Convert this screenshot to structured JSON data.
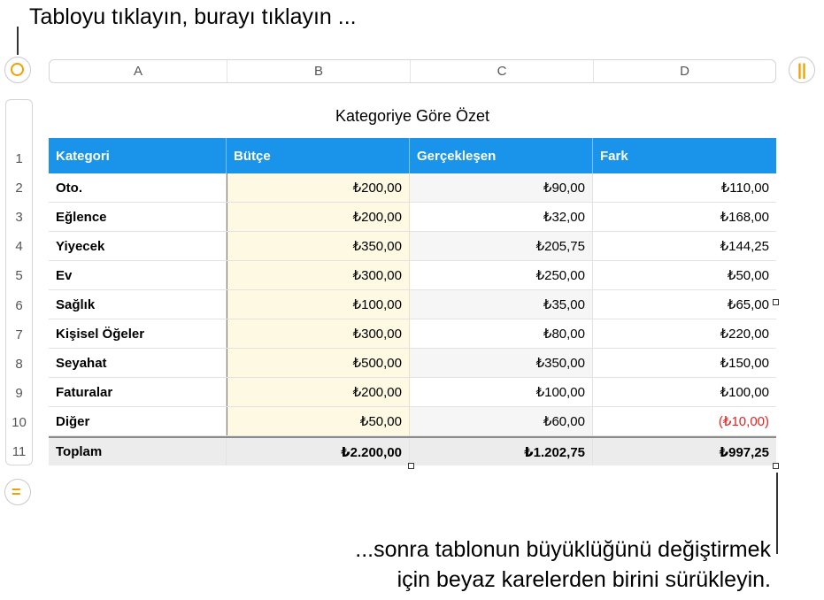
{
  "callouts": {
    "top": "Tabloyu tıklayın, burayı tıklayın ...",
    "bottom_line1": "...sonra tablonun büyüklüğünü değiştirmek",
    "bottom_line2": "için beyaz karelerden birini sürükleyin."
  },
  "colors": {
    "accent": "#f0a000",
    "header_blue": "#1a94ea",
    "negative": "#e02424",
    "budget_fill": "#fdf9e3"
  },
  "icons": {
    "select_table": "circle-select-icon",
    "column_handle": "double-bar-icon",
    "row_handle": "equals-icon"
  },
  "column_letters": [
    "A",
    "B",
    "C",
    "D"
  ],
  "row_numbers": [
    "1",
    "2",
    "3",
    "4",
    "5",
    "6",
    "7",
    "8",
    "9",
    "10",
    "11"
  ],
  "table": {
    "title": "Kategoriye Göre Özet",
    "headers": [
      "Kategori",
      "Bütçe",
      "Gerçekleşen",
      "Fark"
    ],
    "rows": [
      {
        "category": "Oto.",
        "budget": "₺200,00",
        "actual": "₺90,00",
        "diff": "₺110,00"
      },
      {
        "category": "Eğlence",
        "budget": "₺200,00",
        "actual": "₺32,00",
        "diff": "₺168,00"
      },
      {
        "category": "Yiyecek",
        "budget": "₺350,00",
        "actual": "₺205,75",
        "diff": "₺144,25"
      },
      {
        "category": "Ev",
        "budget": "₺300,00",
        "actual": "₺250,00",
        "diff": "₺50,00"
      },
      {
        "category": "Sağlık",
        "budget": "₺100,00",
        "actual": "₺35,00",
        "diff": "₺65,00"
      },
      {
        "category": "Kişisel Öğeler",
        "budget": "₺300,00",
        "actual": "₺80,00",
        "diff": "₺220,00"
      },
      {
        "category": "Seyahat",
        "budget": "₺500,00",
        "actual": "₺350,00",
        "diff": "₺150,00"
      },
      {
        "category": "Faturalar",
        "budget": "₺200,00",
        "actual": "₺100,00",
        "diff": "₺100,00"
      },
      {
        "category": "Diğer",
        "budget": "₺50,00",
        "actual": "₺60,00",
        "diff": "(₺10,00)"
      }
    ],
    "footer": {
      "category": "Toplam",
      "budget": "₺2.200,00",
      "actual": "₺1.202,75",
      "diff": "₺997,25"
    }
  }
}
